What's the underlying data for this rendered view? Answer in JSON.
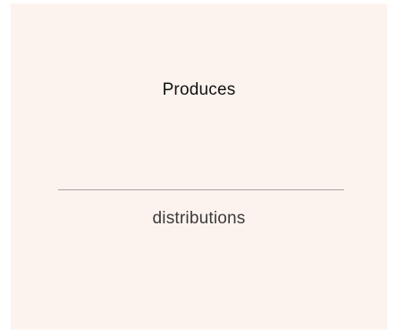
{
  "card": {
    "heading": "Produces",
    "value": "distributions",
    "background_color": "#fdf3ee"
  }
}
